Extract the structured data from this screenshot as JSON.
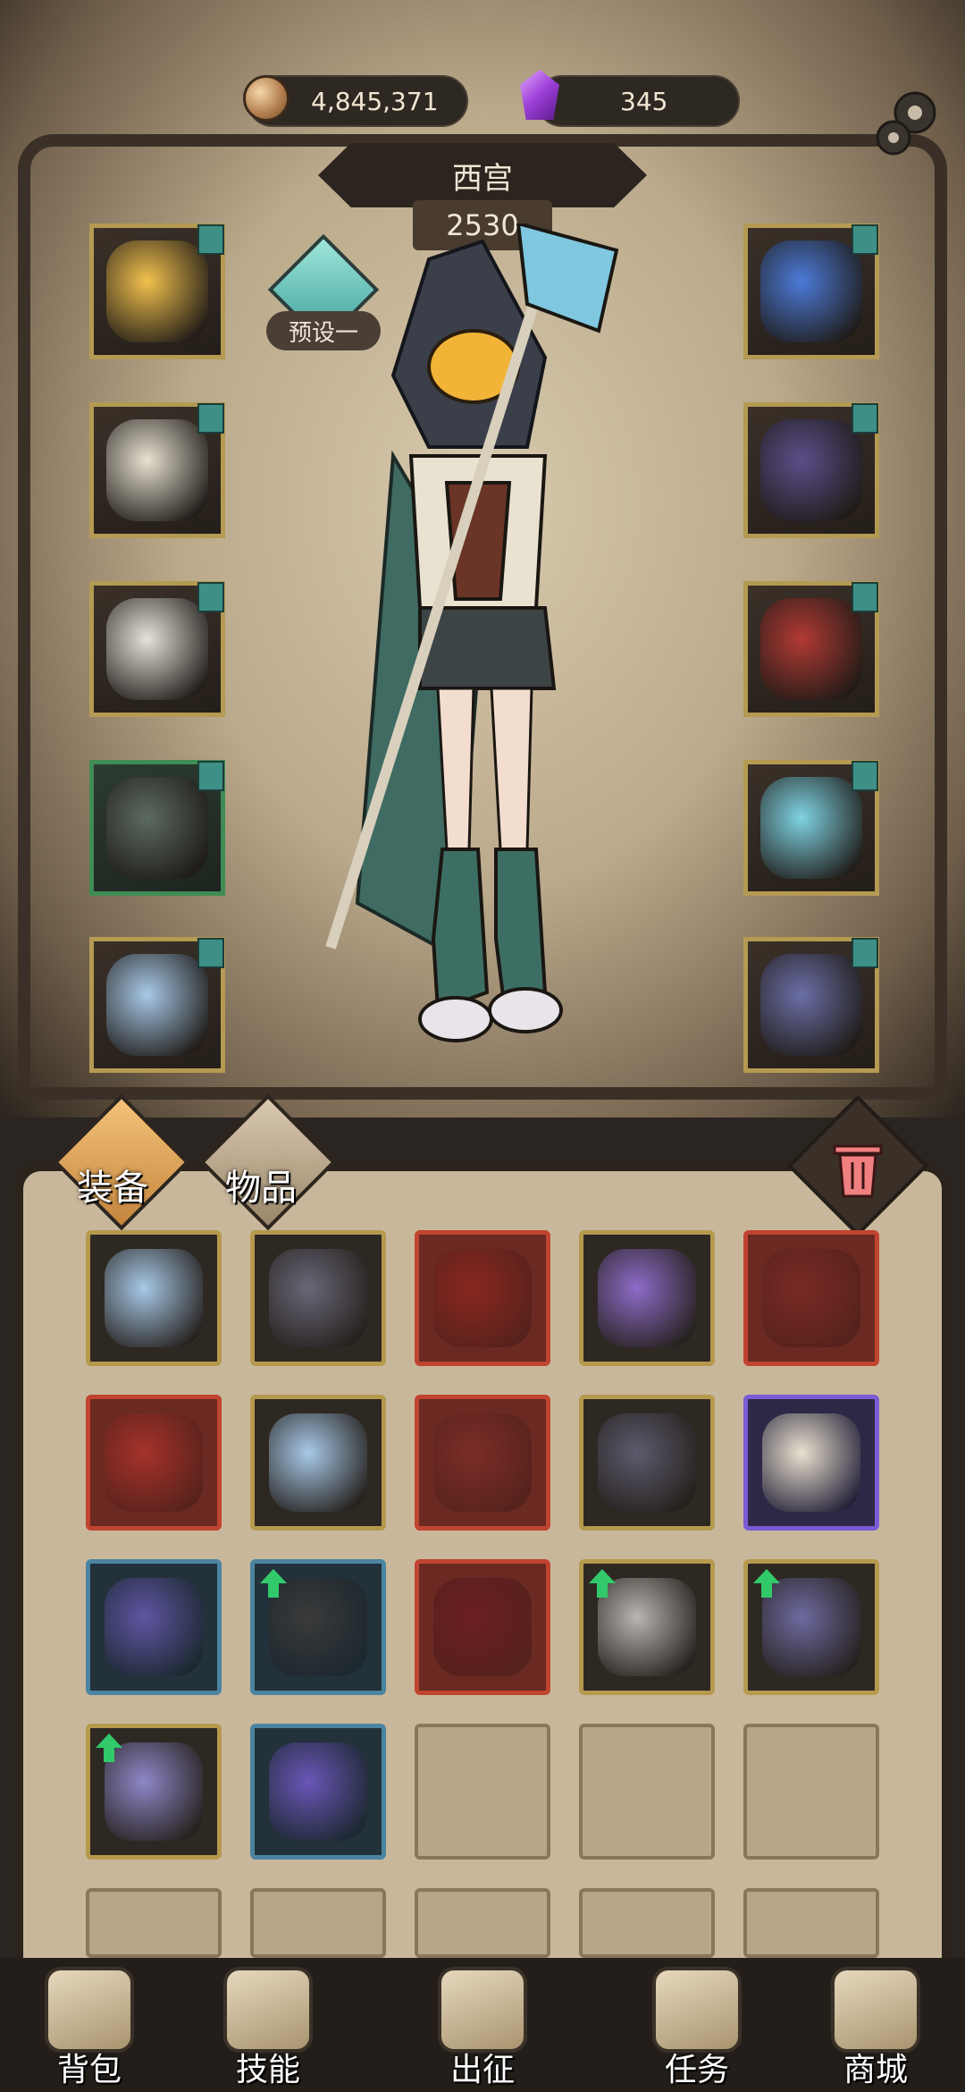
{
  "resources": {
    "gold": {
      "icon": "gold-coin-icon",
      "value": "4,845,371"
    },
    "gems": {
      "icon": "purple-crystal-icon",
      "value": "345"
    }
  },
  "character": {
    "name": "西宫",
    "power": "2530",
    "preset_label": "预设一"
  },
  "left_slots": [
    {
      "name": "hood-slot",
      "icon": "hood-helmet-icon",
      "rarity": "gold",
      "color": "#f2c14e"
    },
    {
      "name": "chest-slot",
      "icon": "chest-armor-icon",
      "rarity": "gold",
      "color": "#e8e2d2"
    },
    {
      "name": "gloves-slot",
      "icon": "gauntlet-icon",
      "rarity": "gold",
      "color": "#e7e3db"
    },
    {
      "name": "pants-slot",
      "icon": "shorts-icon",
      "rarity": "green",
      "color": "#5c6a62"
    },
    {
      "name": "boots-slot",
      "icon": "boots-icon",
      "rarity": "gold",
      "color": "#a7c9e8"
    }
  ],
  "right_slots": [
    {
      "name": "amulet-slot",
      "icon": "eye-amulet-icon",
      "rarity": "gold",
      "color": "#4c7bd9"
    },
    {
      "name": "cape-slot",
      "icon": "cape-icon",
      "rarity": "gold",
      "color": "#5b4f8a"
    },
    {
      "name": "shoulder-slot",
      "icon": "red-pauldron-icon",
      "rarity": "gold",
      "color": "#b23a34"
    },
    {
      "name": "weapon-slot",
      "icon": "staff-icon",
      "rarity": "gold",
      "color": "#7fd3e3"
    },
    {
      "name": "ring-slot",
      "icon": "ring-icon",
      "rarity": "gold",
      "color": "#6b6fa6"
    }
  ],
  "tabs": {
    "equipment": "装备",
    "items": "物品"
  },
  "inventory": [
    {
      "rarity": "gold",
      "icon": "boots-icon",
      "color": "#a7c9e8",
      "upgrade": false
    },
    {
      "rarity": "gold",
      "icon": "gauntlet-icon",
      "color": "#6a6778",
      "upgrade": false
    },
    {
      "rarity": "red",
      "icon": "demon-armor-icon",
      "color": "#8a2820",
      "upgrade": false
    },
    {
      "rarity": "gold",
      "icon": "spear-icon",
      "color": "#8d6cc9",
      "upgrade": false
    },
    {
      "rarity": "red",
      "icon": "red-gauntlet-icon",
      "color": "#7a2a25",
      "upgrade": false
    },
    {
      "rarity": "red",
      "icon": "demon-mask-icon",
      "color": "#a5322a",
      "upgrade": false
    },
    {
      "rarity": "gold",
      "icon": "boots-icon",
      "color": "#a7c9e8",
      "upgrade": false
    },
    {
      "rarity": "red",
      "icon": "sword-icon",
      "color": "#7c2d28",
      "upgrade": false
    },
    {
      "rarity": "gold",
      "icon": "greaves-icon",
      "color": "#5d5a6d",
      "upgrade": false
    },
    {
      "rarity": "purple",
      "icon": "hood-icon",
      "color": "#e9e1cf",
      "upgrade": false
    },
    {
      "rarity": "blue",
      "icon": "staff-icon",
      "color": "#5f56a3",
      "upgrade": false
    },
    {
      "rarity": "blue",
      "icon": "shorts-icon",
      "color": "#3a3a3a",
      "upgrade": true
    },
    {
      "rarity": "red",
      "icon": "scythe-icon",
      "color": "#6b1e23",
      "upgrade": false
    },
    {
      "rarity": "gold",
      "icon": "pickaxe-icon",
      "color": "#b8b6b0",
      "upgrade": true
    },
    {
      "rarity": "gold",
      "icon": "dragon-armor-icon",
      "color": "#6e6aa0",
      "upgrade": true
    },
    {
      "rarity": "gold",
      "icon": "crystal-shoulder-icon",
      "color": "#8f88c9",
      "upgrade": true
    },
    {
      "rarity": "blue",
      "icon": "purple-chest-icon",
      "color": "#6a56b8",
      "upgrade": false
    },
    {
      "rarity": "empty"
    },
    {
      "rarity": "empty"
    },
    {
      "rarity": "empty"
    },
    {
      "rarity": "empty"
    },
    {
      "rarity": "empty"
    },
    {
      "rarity": "empty"
    },
    {
      "rarity": "empty"
    },
    {
      "rarity": "empty"
    }
  ],
  "nav": [
    {
      "name": "nav-backpack",
      "label": "背包",
      "icon": "backpack-icon"
    },
    {
      "name": "nav-skills",
      "label": "技能",
      "icon": "skill-book-icon"
    },
    {
      "name": "nav-expedition",
      "label": "出征",
      "icon": "sword-banner-icon"
    },
    {
      "name": "nav-tasks",
      "label": "任务",
      "icon": "scroll-icon"
    },
    {
      "name": "nav-shop",
      "label": "商城",
      "icon": "shop-crown-icon"
    }
  ]
}
